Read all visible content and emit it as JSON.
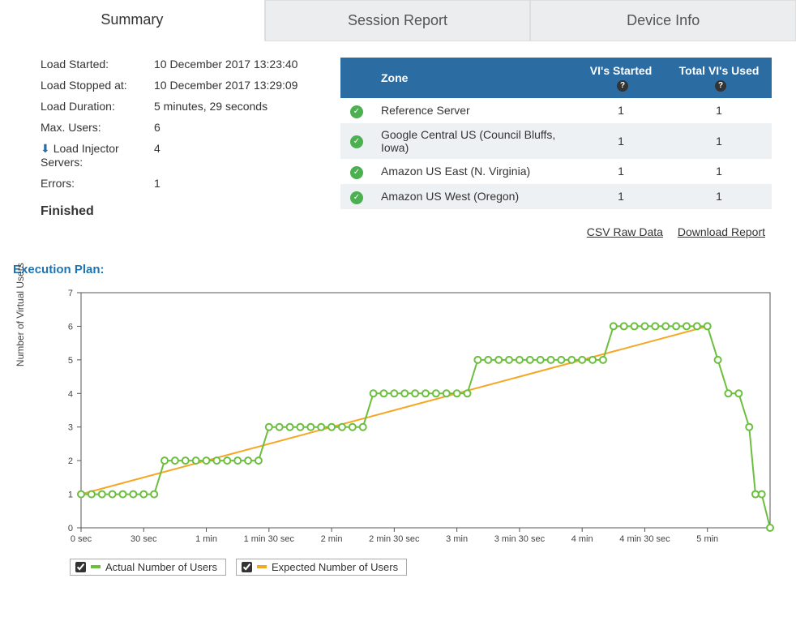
{
  "tabs": {
    "summary": "Summary",
    "session_report": "Session Report",
    "device_info": "Device Info"
  },
  "stats": {
    "load_started_label": "Load Started:",
    "load_started_value": "10 December 2017 13:23:40",
    "load_stopped_label": "Load Stopped at:",
    "load_stopped_value": "10 December 2017 13:29:09",
    "load_duration_label": "Load Duration:",
    "load_duration_value": "5 minutes, 29 seconds",
    "max_users_label": "Max. Users:",
    "max_users_value": "6",
    "injector_label": "Load Injector Servers:",
    "injector_value": "4",
    "errors_label": "Errors:",
    "errors_value": "1",
    "finished": "Finished"
  },
  "zone_table": {
    "headers": {
      "zone": "Zone",
      "started": "VI's Started",
      "total": "Total VI's Used"
    },
    "rows": [
      {
        "name": "Reference Server",
        "started": "1",
        "total": "1"
      },
      {
        "name": "Google Central US (Council Bluffs, Iowa)",
        "started": "1",
        "total": "1"
      },
      {
        "name": "Amazon US East (N. Virginia)",
        "started": "1",
        "total": "1"
      },
      {
        "name": "Amazon US West (Oregon)",
        "started": "1",
        "total": "1"
      }
    ]
  },
  "links": {
    "csv": "CSV Raw Data",
    "download": "Download Report"
  },
  "execution_plan_title": "Execution Plan:",
  "chart_data": {
    "type": "line",
    "ylabel": "Number of Virtual Users",
    "ylim": [
      0,
      7
    ],
    "xticks": [
      "0 sec",
      "30 sec",
      "1 min",
      "1 min 30 sec",
      "2 min",
      "2 min 30 sec",
      "3 min",
      "3 min 30 sec",
      "4 min",
      "4 min 30 sec",
      "5 min"
    ],
    "x_seconds_max": 330,
    "series": [
      {
        "name": "Actual Number of Users",
        "color": "#6cbf3e",
        "points_sec_users": [
          [
            0,
            1
          ],
          [
            5,
            1
          ],
          [
            10,
            1
          ],
          [
            15,
            1
          ],
          [
            20,
            1
          ],
          [
            25,
            1
          ],
          [
            30,
            1
          ],
          [
            35,
            1
          ],
          [
            40,
            2
          ],
          [
            45,
            2
          ],
          [
            50,
            2
          ],
          [
            55,
            2
          ],
          [
            60,
            2
          ],
          [
            65,
            2
          ],
          [
            70,
            2
          ],
          [
            75,
            2
          ],
          [
            80,
            2
          ],
          [
            85,
            2
          ],
          [
            90,
            3
          ],
          [
            95,
            3
          ],
          [
            100,
            3
          ],
          [
            105,
            3
          ],
          [
            110,
            3
          ],
          [
            115,
            3
          ],
          [
            120,
            3
          ],
          [
            125,
            3
          ],
          [
            130,
            3
          ],
          [
            135,
            3
          ],
          [
            140,
            4
          ],
          [
            145,
            4
          ],
          [
            150,
            4
          ],
          [
            155,
            4
          ],
          [
            160,
            4
          ],
          [
            165,
            4
          ],
          [
            170,
            4
          ],
          [
            175,
            4
          ],
          [
            180,
            4
          ],
          [
            185,
            4
          ],
          [
            190,
            5
          ],
          [
            195,
            5
          ],
          [
            200,
            5
          ],
          [
            205,
            5
          ],
          [
            210,
            5
          ],
          [
            215,
            5
          ],
          [
            220,
            5
          ],
          [
            225,
            5
          ],
          [
            230,
            5
          ],
          [
            235,
            5
          ],
          [
            240,
            5
          ],
          [
            245,
            5
          ],
          [
            250,
            5
          ],
          [
            255,
            6
          ],
          [
            260,
            6
          ],
          [
            265,
            6
          ],
          [
            270,
            6
          ],
          [
            275,
            6
          ],
          [
            280,
            6
          ],
          [
            285,
            6
          ],
          [
            290,
            6
          ],
          [
            295,
            6
          ],
          [
            300,
            6
          ],
          [
            305,
            5
          ],
          [
            310,
            4
          ],
          [
            315,
            4
          ],
          [
            320,
            3
          ],
          [
            323,
            1
          ],
          [
            326,
            1
          ],
          [
            330,
            0
          ]
        ]
      },
      {
        "name": "Expected Number of Users",
        "color": "#f5a623",
        "line_sec_users": [
          [
            0,
            1
          ],
          [
            300,
            6
          ]
        ]
      }
    ]
  },
  "legend": {
    "actual": "Actual Number of Users",
    "expected": "Expected Number of Users"
  }
}
